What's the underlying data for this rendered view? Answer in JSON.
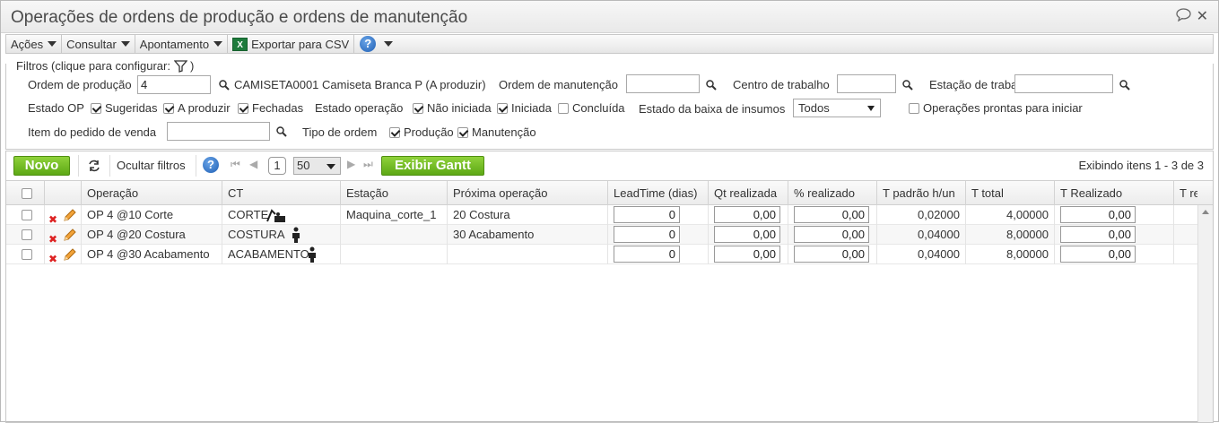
{
  "window": {
    "title": "Operações de ordens de produção e ordens de manutenção"
  },
  "menu": {
    "acoes": "Ações",
    "consultar": "Consultar",
    "apontamento": "Apontamento",
    "exportar": "Exportar para CSV",
    "xls_glyph": "X",
    "help_glyph": "?"
  },
  "filters": {
    "legend": "Filtros (clique para configurar:",
    "legend_close": ")",
    "ordem_producao_label": "Ordem de produção",
    "ordem_producao_value": "4",
    "ordem_producao_desc": "CAMISETA0001 Camiseta Branca P (A produzir)",
    "ordem_manutencao_label": "Ordem de manutenção",
    "ordem_manutencao_value": "",
    "centro_trabalho_label": "Centro de trabalho",
    "centro_trabalho_value": "",
    "estacao_trabalho_label": "Estação de trabalho",
    "estacao_trabalho_value": "",
    "estado_op_label": "Estado OP",
    "estado_op_options": [
      {
        "label": "Sugeridas",
        "checked": true
      },
      {
        "label": "A produzir",
        "checked": true
      },
      {
        "label": "Fechadas",
        "checked": true
      }
    ],
    "estado_operacao_label": "Estado operação",
    "estado_operacao_options": [
      {
        "label": "Não iniciada",
        "checked": true
      },
      {
        "label": "Iniciada",
        "checked": true
      },
      {
        "label": "Concluída",
        "checked": false
      }
    ],
    "estado_baixa_label": "Estado da baixa de insumos",
    "estado_baixa_value": "Todos",
    "operacoes_prontas_label": "Operações prontas para iniciar",
    "operacoes_prontas_checked": false,
    "item_pedido_label": "Item do pedido de venda",
    "item_pedido_value": "",
    "tipo_ordem_label": "Tipo de ordem",
    "tipo_ordem_options": [
      {
        "label": "Produção",
        "checked": true
      },
      {
        "label": "Manutenção",
        "checked": true
      }
    ]
  },
  "toolbar": {
    "novo": "Novo",
    "ocultar_filtros": "Ocultar filtros",
    "help_glyph": "?",
    "page": "1",
    "page_size": "50",
    "exibir_gantt": "Exibir Gantt",
    "showing": "Exibindo itens 1 - 3 de 3"
  },
  "table": {
    "columns": [
      "Operação",
      "CT",
      "Estação",
      "Próxima operação",
      "LeadTime (dias)",
      "Qt realizada",
      "% realizado",
      "T padrão h/un",
      "T total",
      "T Realizado",
      "T re"
    ],
    "rows": [
      {
        "operacao": "OP 4 @10 Corte",
        "ct": "CORTE",
        "ct_icon": "machine-icon",
        "estacao": "Maquina_corte_1",
        "proxima": "20 Costura",
        "leadtime": "0",
        "qt": "0,00",
        "pct": "0,00",
        "tpadrao": "0,02000",
        "ttotal": "4,00000",
        "trealizado": "0,00"
      },
      {
        "operacao": "OP 4 @20 Costura",
        "ct": "COSTURA",
        "ct_icon": "person-icon",
        "estacao": "",
        "proxima": "30 Acabamento",
        "leadtime": "0",
        "qt": "0,00",
        "pct": "0,00",
        "tpadrao": "0,04000",
        "ttotal": "8,00000",
        "trealizado": "0,00"
      },
      {
        "operacao": "OP 4 @30 Acabamento",
        "ct": "ACABAMENTO",
        "ct_icon": "person-icon",
        "estacao": "",
        "proxima": "",
        "leadtime": "0",
        "qt": "0,00",
        "pct": "0,00",
        "tpadrao": "0,04000",
        "ttotal": "8,00000",
        "trealizado": "0,00"
      }
    ]
  },
  "colors": {
    "green_button": "#6bb81f",
    "delete_red": "#dd2222",
    "edit_orange": "#e8901a"
  }
}
